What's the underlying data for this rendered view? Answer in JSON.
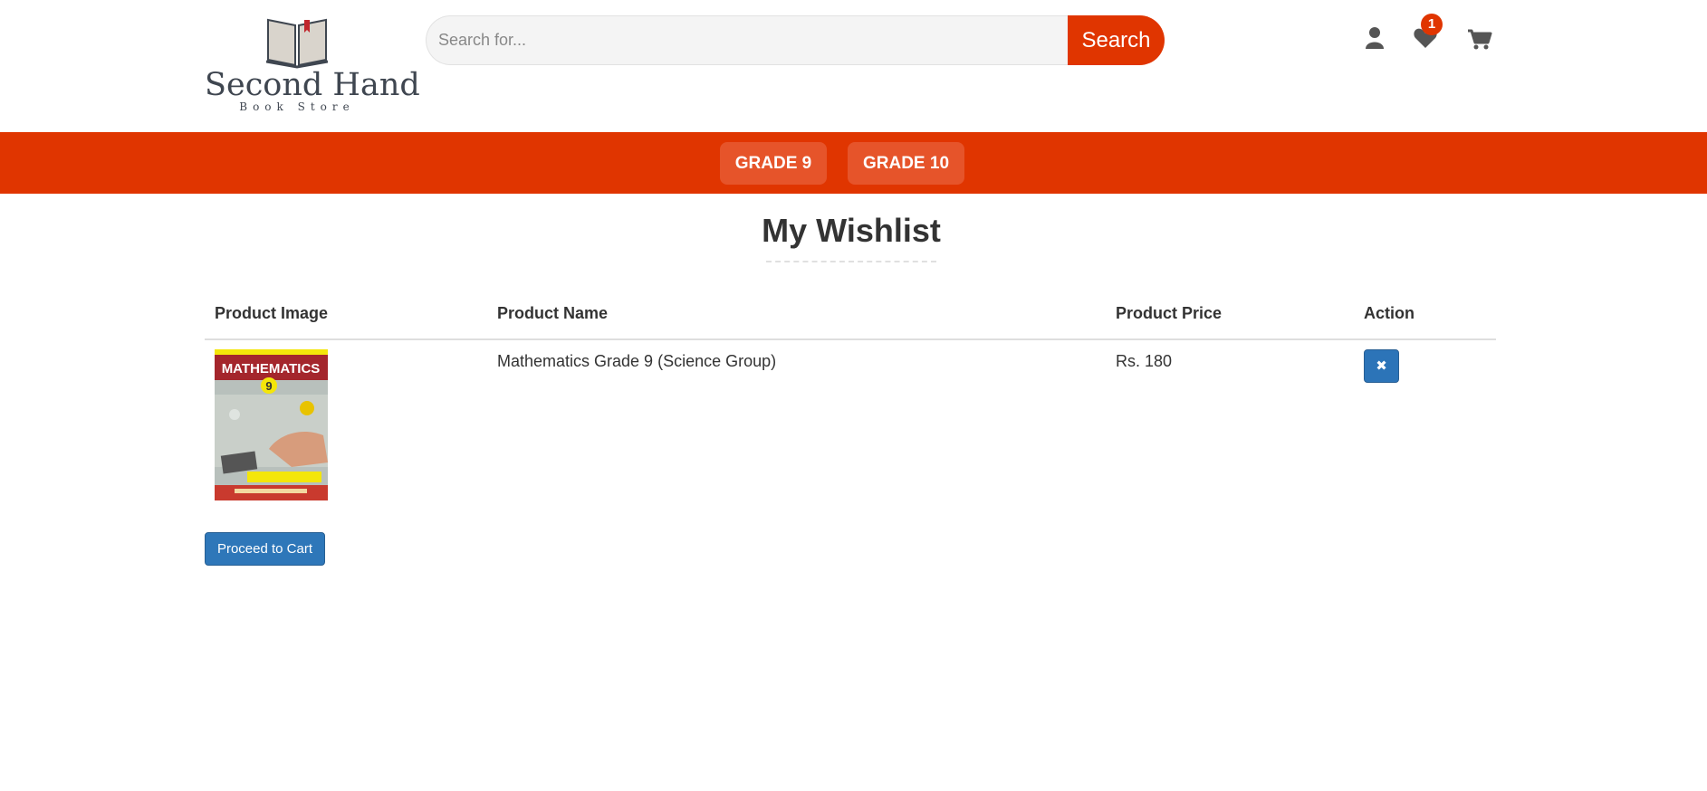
{
  "header": {
    "logo": {
      "title": "Second Hand",
      "subtitle": "Book Store"
    },
    "search": {
      "placeholder": "Search for...",
      "value": "",
      "button_label": "Search"
    },
    "icons": {
      "user": "user-icon",
      "wishlist": "heart-icon",
      "cart": "cart-icon"
    },
    "wishlist_count": "1"
  },
  "nav": {
    "items": [
      {
        "label": "GRADE 9"
      },
      {
        "label": "GRADE 10"
      }
    ]
  },
  "main": {
    "title": "My Wishlist",
    "table": {
      "columns": [
        "Product Image",
        "Product Name",
        "Product Price",
        "Action"
      ],
      "rows": [
        {
          "image": {
            "cover_title": "MATHEMATICS",
            "cover_grade": "9"
          },
          "name": "Mathematics Grade 9 (Science Group)",
          "price": "Rs. 180",
          "action_icon": "close-icon",
          "action_glyph": "✖"
        }
      ]
    },
    "proceed_label": "Proceed to Cart"
  },
  "colors": {
    "brand": "#e03500",
    "primary_button": "#2c74b8"
  }
}
